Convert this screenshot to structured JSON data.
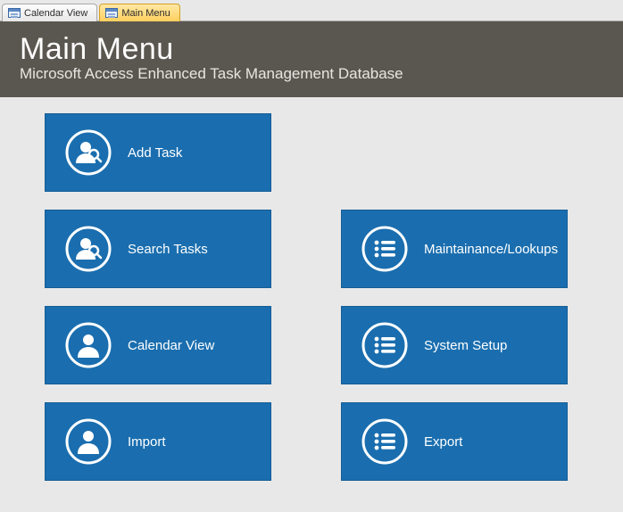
{
  "tabs": [
    {
      "label": "Calendar View",
      "active": false
    },
    {
      "label": "Main Menu",
      "active": true
    }
  ],
  "header": {
    "title": "Main Menu",
    "subtitle": "Microsoft Access Enhanced Task Management Database"
  },
  "tiles": {
    "add_task": "Add Task",
    "search_tasks": "Search Tasks",
    "calendar_view": "Calendar View",
    "import": "Import",
    "maintenance": "Maintainance/Lookups",
    "system_setup": "System Setup",
    "export": "Export"
  },
  "colors": {
    "tile": "#1a6eaf",
    "tile_border": "#155d95",
    "header_bg": "#5a5750"
  }
}
